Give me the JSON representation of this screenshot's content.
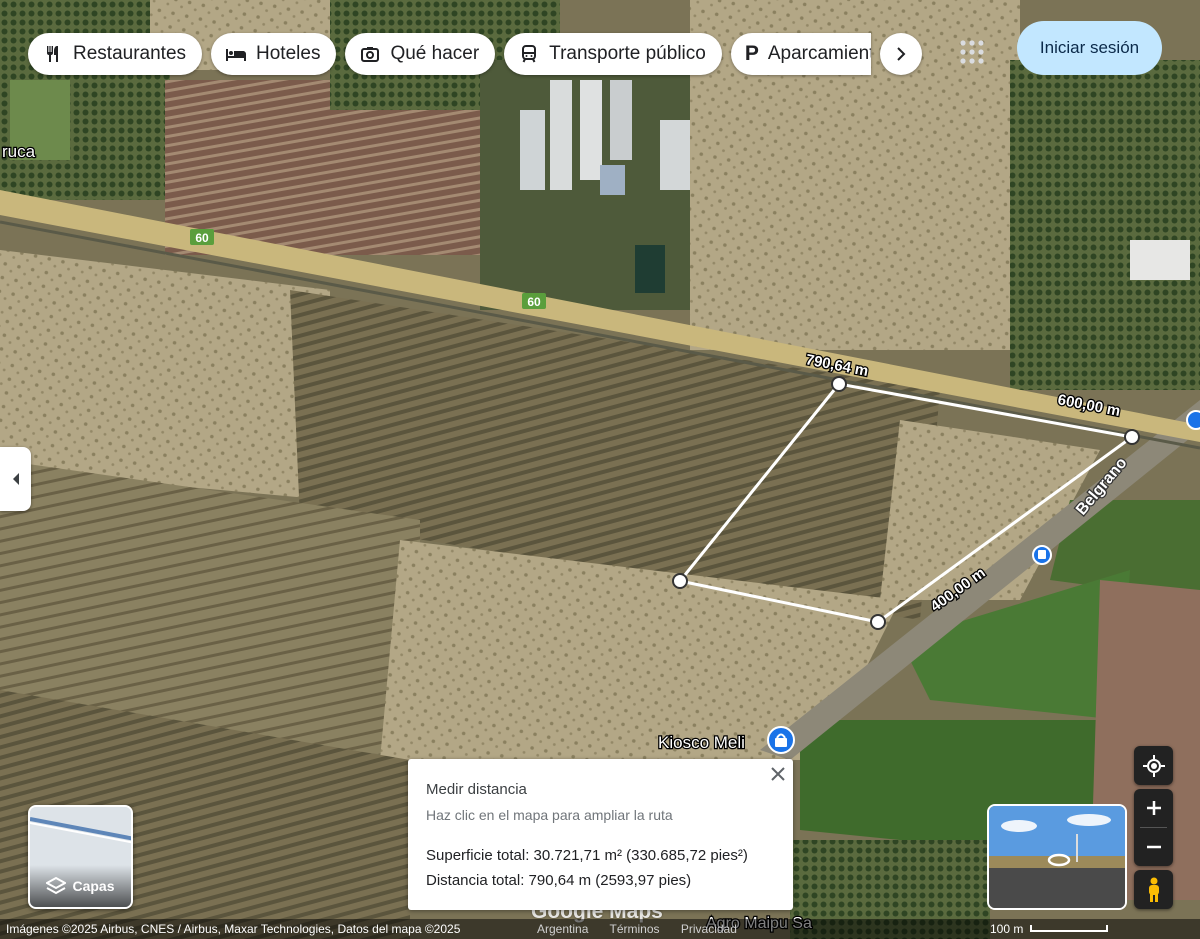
{
  "chips": [
    {
      "label": "Restaurantes",
      "icon": "restaurant-icon"
    },
    {
      "label": "Hoteles",
      "icon": "hotel-icon"
    },
    {
      "label": "Qué hacer",
      "icon": "camera-icon"
    },
    {
      "label": "Transporte público",
      "icon": "transit-icon"
    },
    {
      "label": "Aparcamiento",
      "icon": "parking-icon"
    }
  ],
  "signin_label": "Iniciar sesión",
  "layers_label": "Capas",
  "map": {
    "road_labels": {
      "route_60_a": "60",
      "route_60_b": "60",
      "belgrano": "Belgrano"
    },
    "place_labels": {
      "ruca": "ruca",
      "kiosco": "Kiosco Meli",
      "agro": "Agro Maipu Sa"
    },
    "segment_labels": {
      "seg1": "790,64 m",
      "seg2": "600,00 m",
      "seg3": "400,00 m"
    },
    "watermark": "Google Maps"
  },
  "measure": {
    "title": "Medir distancia",
    "hint": "Haz clic en el mapa para ampliar la ruta",
    "area": "Superficie total: 30.721,71 m² (330.685,72 pies²)",
    "distance": "Distancia total: 790,64 m (2593,97 pies)"
  },
  "footer": {
    "attribution": "Imágenes ©2025 Airbus, CNES / Airbus, Maxar Technologies, Datos del mapa ©2025",
    "country": "Argentina",
    "terms": "Términos",
    "privacy": "Privacidad",
    "scale": "100 m"
  },
  "colors": {
    "road": "#c9b77c",
    "route_shield": "#5a9e3c",
    "measure_line": "#ffffff",
    "signin_bg": "#c2e7ff",
    "transit_pin": "#1a73e8"
  }
}
